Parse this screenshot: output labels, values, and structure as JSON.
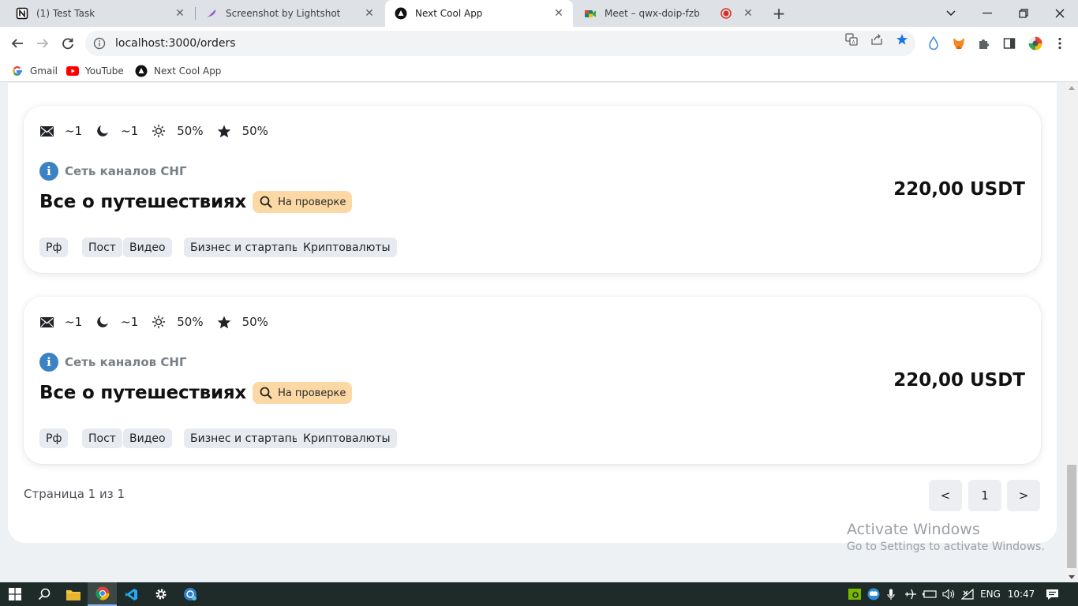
{
  "browser": {
    "tabs": [
      {
        "title": "(1) Test Task",
        "icon": "notion-icon",
        "active": false
      },
      {
        "title": "Screenshot by Lightshot",
        "icon": "lightshot-feather-icon",
        "active": false
      },
      {
        "title": "Next Cool App",
        "icon": "next-app-icon",
        "active": true
      },
      {
        "title": "Meet – qwx-doip-fzb",
        "icon": "google-meet-icon",
        "active": false
      }
    ],
    "url": "localhost:3000/orders",
    "bookmarks": [
      {
        "label": "Gmail",
        "icon": "google-g-icon"
      },
      {
        "label": "YouTube",
        "icon": "youtube-icon"
      },
      {
        "label": "Next Cool App",
        "icon": "next-app-icon"
      }
    ]
  },
  "orders": [
    {
      "stats": {
        "posts": "~1",
        "night": "~1",
        "day": "50%",
        "rating": "50%"
      },
      "network": "Сеть каналов СНГ",
      "title": "Все о путешествиях",
      "status": "На проверке",
      "price": "220,00 USDT",
      "tags": [
        "Рф",
        "Пост",
        "Видео",
        "Бизнес и стартапы",
        "Криптовалюты"
      ]
    },
    {
      "stats": {
        "posts": "~1",
        "night": "~1",
        "day": "50%",
        "rating": "50%"
      },
      "network": "Сеть каналов СНГ",
      "title": "Все о путешествиях",
      "status": "На проверке",
      "price": "220,00 USDT",
      "tags": [
        "Рф",
        "Пост",
        "Видео",
        "Бизнес и стартапы",
        "Криптовалюты"
      ]
    }
  ],
  "pagination": {
    "info": "Страница 1 из 1",
    "prev": "<",
    "current": "1",
    "next": ">"
  },
  "watermark": {
    "line1": "Activate Windows",
    "line2": "Go to Settings to activate Windows."
  },
  "taskbar": {
    "language": "ENG",
    "time": "10:47"
  },
  "colors": {
    "status_badge": "#fcd9a4",
    "info_badge": "#3b82c4",
    "tag_bg": "#e7eaee",
    "bookmark_star": "#1a73e8"
  }
}
